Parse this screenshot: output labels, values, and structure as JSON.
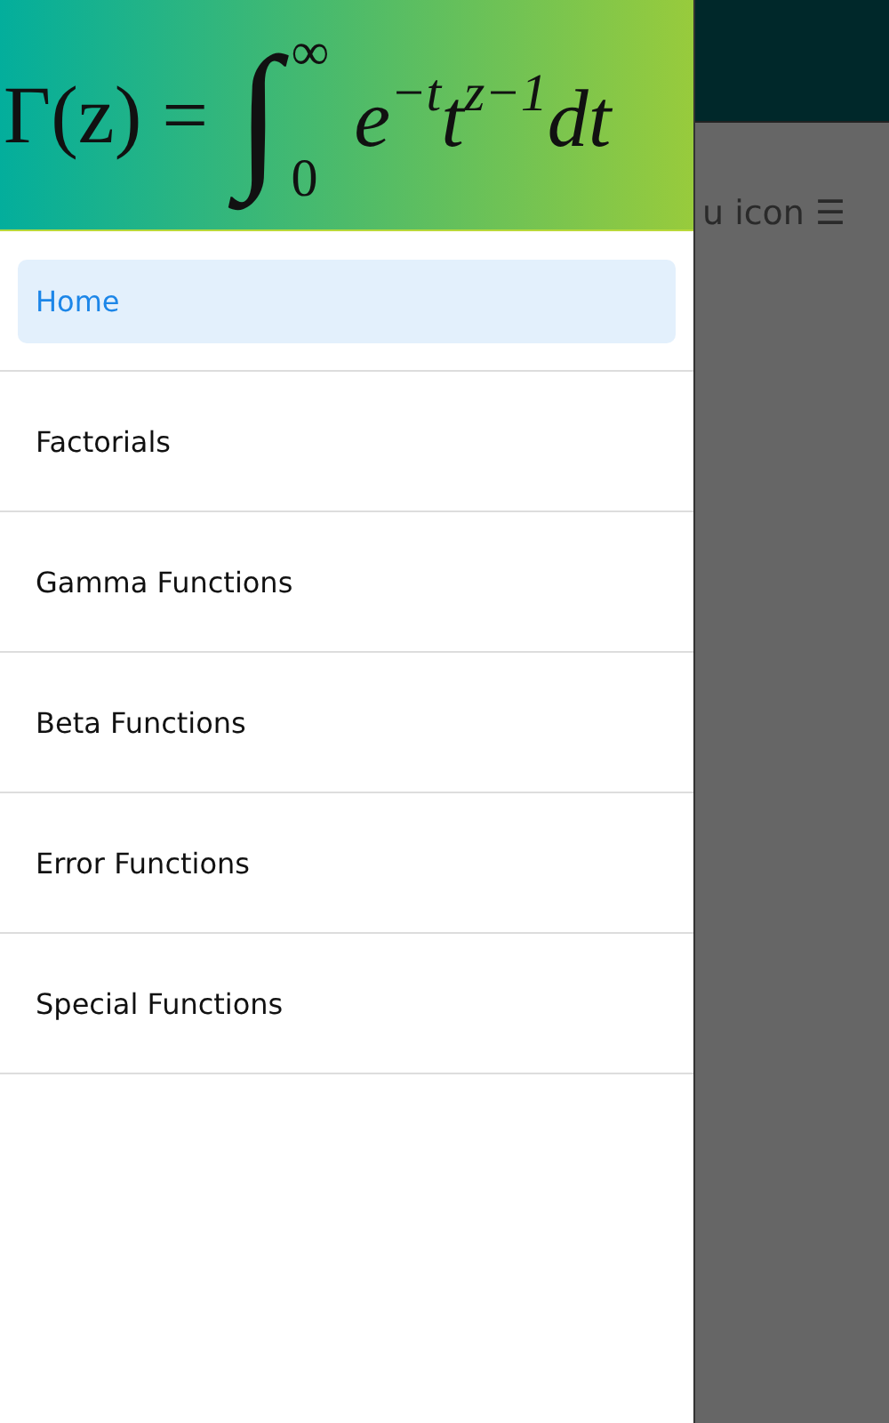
{
  "drawer": {
    "header": {
      "formula": {
        "lhs": "Γ(z) =",
        "integral": "∫",
        "upper_limit": "∞",
        "lower_limit": "0",
        "integrand": "e$^{−t}$t$^{z−1}$dt"
      }
    },
    "items": [
      {
        "label": "Home",
        "selected": true
      },
      {
        "label": "Factorials",
        "selected": false
      },
      {
        "label": "Gamma Functions",
        "selected": false
      },
      {
        "label": "Beta Functions",
        "selected": false
      },
      {
        "label": "Error Functions",
        "selected": false
      },
      {
        "label": "Special Functions",
        "selected": false
      }
    ]
  },
  "background": {
    "text": "u icon ☰"
  }
}
